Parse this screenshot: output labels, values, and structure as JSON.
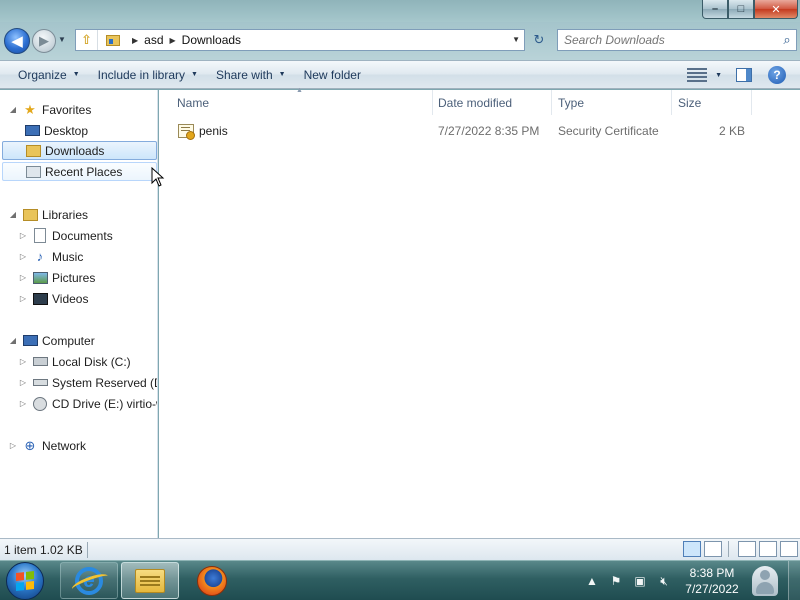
{
  "window": {
    "caption": {
      "minimize": "–",
      "maximize": "□",
      "close": "✕"
    }
  },
  "nav": {
    "back_glyph": "◀",
    "forward_glyph": "▶",
    "address": {
      "crumbs": [
        "asd",
        "Downloads"
      ]
    },
    "search": {
      "placeholder": "Search Downloads"
    }
  },
  "toolbar": {
    "organize": "Organize",
    "include_in_library": "Include in library",
    "share_with": "Share with",
    "new_folder": "New folder"
  },
  "sidebar": {
    "favorites": {
      "label": "Favorites",
      "items": [
        {
          "label": "Desktop"
        },
        {
          "label": "Downloads"
        },
        {
          "label": "Recent Places"
        }
      ]
    },
    "libraries": {
      "label": "Libraries",
      "items": [
        {
          "label": "Documents"
        },
        {
          "label": "Music"
        },
        {
          "label": "Pictures"
        },
        {
          "label": "Videos"
        }
      ]
    },
    "computer": {
      "label": "Computer",
      "items": [
        {
          "label": "Local Disk (C:)"
        },
        {
          "label": "System Reserved (D:"
        },
        {
          "label": "CD Drive (E:) virtio-w"
        }
      ]
    },
    "network": {
      "label": "Network"
    }
  },
  "filelist": {
    "columns": {
      "name": "Name",
      "date": "Date modified",
      "type": "Type",
      "size": "Size"
    },
    "rows": [
      {
        "name": "penis",
        "date": "7/27/2022 8:35 PM",
        "type": "Security Certificate",
        "size": "2 KB"
      }
    ]
  },
  "statusbar": {
    "text": "1 item 1.02 KB"
  },
  "taskbar": {
    "clock": {
      "time": "8:38 PM",
      "date": "7/27/2022"
    }
  },
  "colors": {
    "selection_bg": "#cde6fb",
    "selection_border": "#84acdd",
    "taskbar": "#2f5f62"
  }
}
